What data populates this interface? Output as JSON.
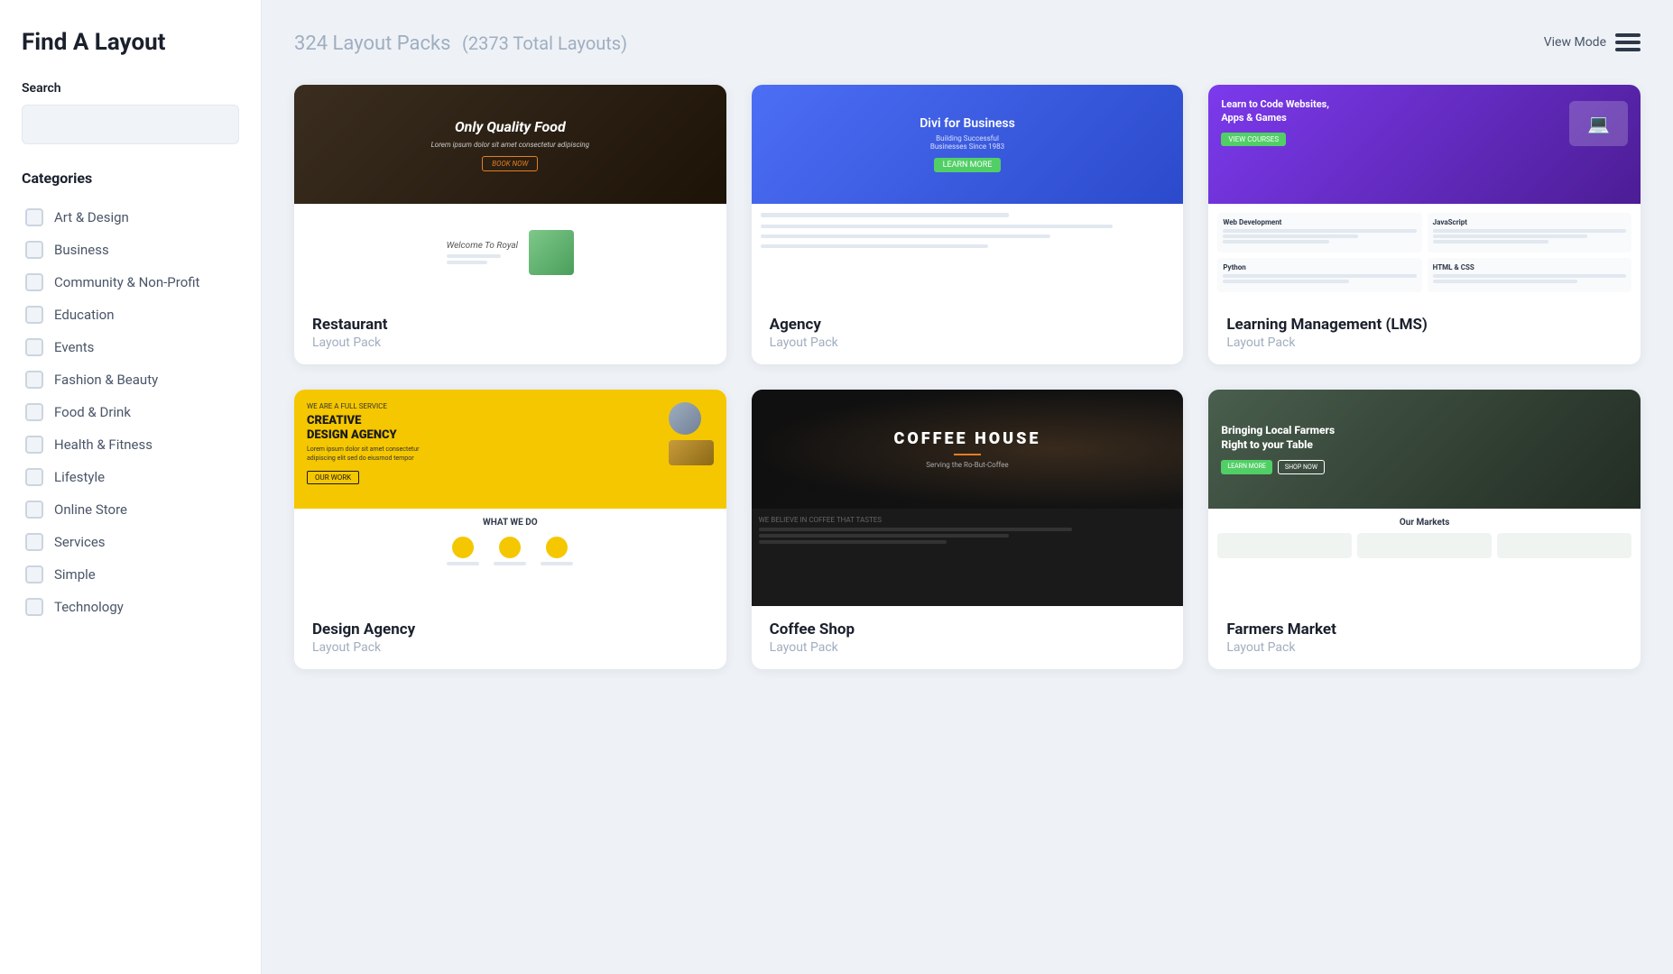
{
  "sidebar": {
    "title": "Find A Layout",
    "search": {
      "label": "Search",
      "placeholder": ""
    },
    "categories_label": "Categories",
    "categories": [
      {
        "id": "art-design",
        "name": "Art & Design",
        "checked": false
      },
      {
        "id": "business",
        "name": "Business",
        "checked": false
      },
      {
        "id": "community",
        "name": "Community & Non-Profit",
        "checked": false
      },
      {
        "id": "education",
        "name": "Education",
        "checked": false
      },
      {
        "id": "events",
        "name": "Events",
        "checked": false
      },
      {
        "id": "fashion-beauty",
        "name": "Fashion & Beauty",
        "checked": false
      },
      {
        "id": "food-drink",
        "name": "Food & Drink",
        "checked": false
      },
      {
        "id": "health-fitness",
        "name": "Health & Fitness",
        "checked": false
      },
      {
        "id": "lifestyle",
        "name": "Lifestyle",
        "checked": false
      },
      {
        "id": "online-store",
        "name": "Online Store",
        "checked": false
      },
      {
        "id": "services",
        "name": "Services",
        "checked": false
      },
      {
        "id": "simple",
        "name": "Simple",
        "checked": false
      },
      {
        "id": "technology",
        "name": "Technology",
        "checked": false
      }
    ]
  },
  "header": {
    "count": "324 Layout Packs",
    "total": "(2373 Total Layouts)",
    "view_mode_label": "View Mode"
  },
  "cards": [
    {
      "id": "restaurant",
      "name": "Restaurant",
      "type": "Layout Pack",
      "preview_type": "restaurant"
    },
    {
      "id": "agency",
      "name": "Agency",
      "type": "Layout Pack",
      "preview_type": "agency"
    },
    {
      "id": "lms",
      "name": "Learning Management (LMS)",
      "type": "Layout Pack",
      "preview_type": "lms"
    },
    {
      "id": "design-agency",
      "name": "Design Agency",
      "type": "Layout Pack",
      "preview_type": "design"
    },
    {
      "id": "coffee-shop",
      "name": "Coffee Shop",
      "type": "Layout Pack",
      "preview_type": "coffee"
    },
    {
      "id": "farmers-market",
      "name": "Farmers Market",
      "type": "Layout Pack",
      "preview_type": "farmers"
    }
  ]
}
